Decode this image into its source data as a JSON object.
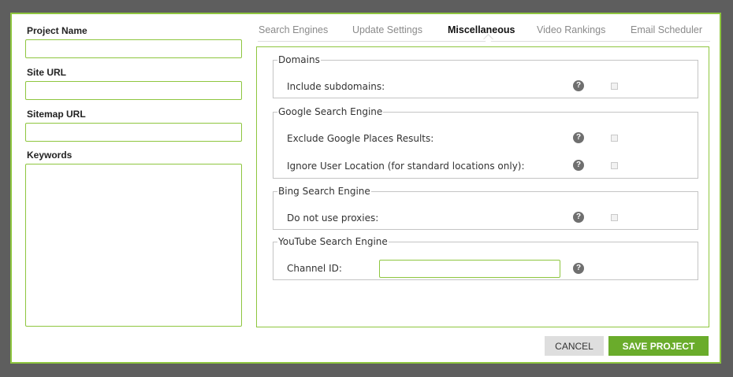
{
  "colors": {
    "accent": "#8ec63f",
    "save_button": "#6aac2b",
    "overlay": "#5e5e5e"
  },
  "project": {
    "name_label": "Project Name",
    "name_value": "",
    "site_url_label": "Site URL",
    "site_url_value": "",
    "sitemap_url_label": "Sitemap URL",
    "sitemap_url_value": "",
    "keywords_label": "Keywords",
    "keywords_value": ""
  },
  "tabs": [
    {
      "label": "Search Engines",
      "active": false
    },
    {
      "label": "Update Settings",
      "active": false
    },
    {
      "label": "Miscellaneous",
      "active": true
    },
    {
      "label": "Video Rankings",
      "active": false
    },
    {
      "label": "Email Scheduler",
      "active": false
    }
  ],
  "misc": {
    "domains": {
      "legend": "Domains",
      "include_subdomains": "Include subdomains:",
      "include_subdomains_checked": false
    },
    "google": {
      "legend": "Google Search Engine",
      "exclude_places": "Exclude Google Places Results:",
      "exclude_places_checked": false,
      "ignore_location": "Ignore User Location (for standard locations only):",
      "ignore_location_checked": false
    },
    "bing": {
      "legend": "Bing Search Engine",
      "no_proxies": "Do not use proxies:",
      "no_proxies_checked": false
    },
    "youtube": {
      "legend": "YouTube Search Engine",
      "channel_id_label": "Channel ID:",
      "channel_id_value": ""
    },
    "help_glyph": "?"
  },
  "actions": {
    "cancel": "CANCEL",
    "save": "SAVE PROJECT"
  }
}
